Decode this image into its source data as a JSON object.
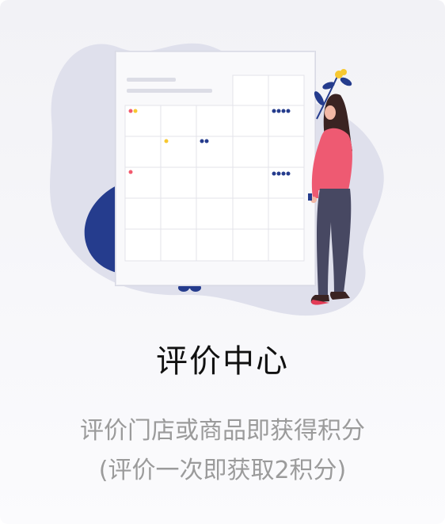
{
  "card": {
    "title": "评价中心",
    "description_line1": "评价门店或商品即获得积分",
    "description_line2": "(评价一次即获取2积分)"
  },
  "illustration": {
    "name": "review-calendar-with-woman",
    "colors": {
      "blob": "#dfe0ec",
      "leaf": "#253c8d",
      "dot_red": "#f25a6e",
      "dot_yellow": "#f7c831",
      "shirt": "#ee5a72",
      "pants": "#474862",
      "hair": "#3a2322"
    }
  }
}
